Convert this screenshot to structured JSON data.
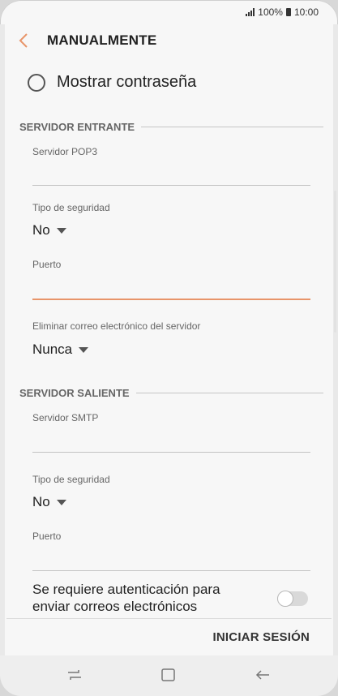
{
  "status": {
    "battery_text": "100%",
    "time": "10:00"
  },
  "header": {
    "title": "MANUALMENTE",
    "back_icon": "chevron-left-icon"
  },
  "show_password": {
    "label": "Mostrar contraseña",
    "checked": false
  },
  "incoming": {
    "section_title": "SERVIDOR ENTRANTE",
    "server_label": "Servidor POP3",
    "server_value": "",
    "security_label": "Tipo de seguridad",
    "security_value": "No",
    "port_label": "Puerto",
    "port_value": "",
    "delete_label": "Eliminar correo electrónico del servidor",
    "delete_value": "Nunca"
  },
  "outgoing": {
    "section_title": "SERVIDOR SALIENTE",
    "server_label": "Servidor SMTP",
    "server_value": "",
    "security_label": "Tipo de seguridad",
    "security_value": "No",
    "port_label": "Puerto",
    "port_value": ""
  },
  "auth": {
    "label": "Se requiere autenticación para enviar correos electrónicos",
    "enabled": false
  },
  "footer": {
    "signin_label": "INICIAR SESIÓN"
  },
  "navbar": {
    "recent_icon": "recent-apps-icon",
    "home_icon": "home-icon",
    "back_icon": "back-arrow-icon"
  },
  "colors": {
    "accent": "#e8956a",
    "text": "#222222",
    "muted": "#666666",
    "background": "#f7f7f7"
  }
}
